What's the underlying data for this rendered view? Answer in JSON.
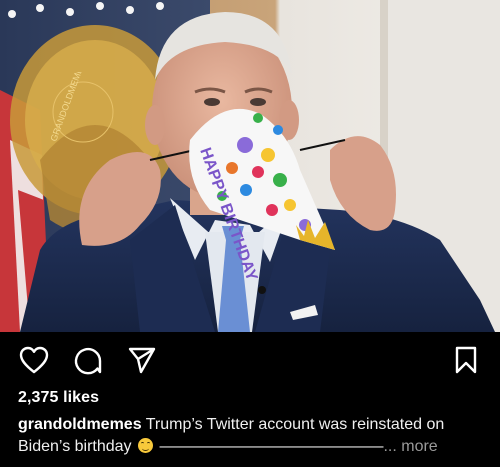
{
  "post": {
    "photo_alt": "man wearing party hat as face mask",
    "hat_text": "HAPPY BIRTHDAY",
    "watermark_text": "GRANDOLDMEMES"
  },
  "actions": {
    "like_icon": "heart-icon",
    "comment_icon": "comment-icon",
    "share_icon": "paper-plane-icon",
    "save_icon": "bookmark-icon"
  },
  "likes_text": "2,375 likes",
  "caption": {
    "username": "grandoldmemes",
    "text": "Trump’s Twitter account was reinstated on Biden’s birthday",
    "emoji": "😄",
    "dashes": "——————————————",
    "more_label": "... more"
  },
  "colors": {
    "background": "#000000",
    "text": "#ffffff",
    "muted": "#9a9a9a"
  }
}
